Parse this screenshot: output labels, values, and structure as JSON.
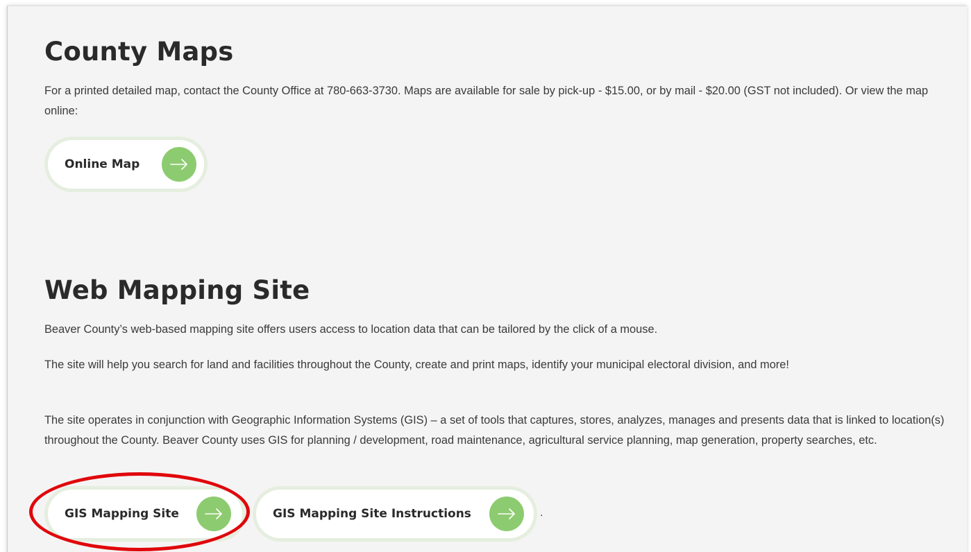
{
  "county_maps": {
    "heading": "County Maps",
    "description": "For a printed detailed map, contact the County Office at 780-663-3730. Maps are available for sale by pick-up - $15.00, or by mail - $20.00 (GST not included). Or view the map online:",
    "button_label": "Online Map",
    "button_icon": "arrow-right-icon"
  },
  "web_mapping": {
    "heading": "Web Mapping Site",
    "paragraphs": [
      "Beaver County’s web-based mapping site offers users access to location data that can be tailored by the click of a mouse.",
      "The site will help you search for land and facilities throughout the County, create and print maps, identify your municipal electoral division, and more!",
      "The site operates in conjunction with Geographic Information Systems (GIS) – a set of tools that captures, stores, analyzes, manages and presents data that is linked to location(s) throughout the County. Beaver County uses GIS for planning / development, road maintenance, agricultural service planning, map generation, property searches, etc."
    ],
    "buttons": [
      {
        "label": "GIS Mapping Site",
        "icon": "arrow-right-icon"
      },
      {
        "label": "GIS Mapping Site Instructions",
        "icon": "arrow-right-icon"
      }
    ],
    "trailing_text": "."
  },
  "colors": {
    "accent_green": "#8dcb70",
    "pill_outline": "#e5eedf",
    "highlight_red": "#e0070b",
    "page_bg": "#f5f4f4"
  }
}
